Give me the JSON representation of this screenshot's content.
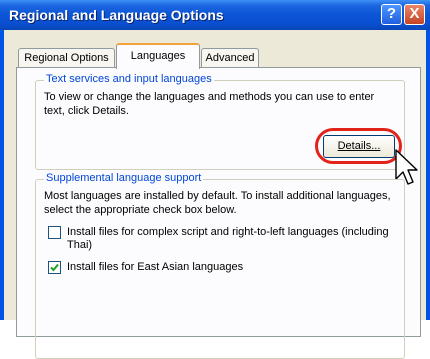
{
  "window": {
    "title": "Regional and Language Options",
    "help_glyph": "?",
    "close_glyph": "X"
  },
  "tabs": [
    {
      "label": "Regional Options",
      "selected": false
    },
    {
      "label": "Languages",
      "selected": true
    },
    {
      "label": "Advanced",
      "selected": false
    }
  ],
  "text_services": {
    "title": "Text services and input languages",
    "description_line1": "To view or change the languages and methods you can use to enter",
    "description_line2": "text, click Details.",
    "details_button": "Details..."
  },
  "supplemental": {
    "title": "Supplemental language support",
    "description_line1": "Most languages are installed by default. To install additional languages,",
    "description_line2": "select the appropriate check box below.",
    "options": [
      {
        "label_line1": "Install files for complex script and right-to-left languages (including",
        "label_line2": "Thai)",
        "checked": false
      },
      {
        "label_line1": "Install files for East Asian languages",
        "label_line2": "",
        "checked": true
      }
    ]
  },
  "colors": {
    "titlebar": "#0a4fd0",
    "groupbox_title": "#0046d5",
    "highlight_ring": "#e2231a",
    "active_tab_accent": "#f2a23b"
  },
  "icons": [
    "help-icon",
    "close-icon",
    "mouse-pointer-icon",
    "checkmark-icon"
  ]
}
